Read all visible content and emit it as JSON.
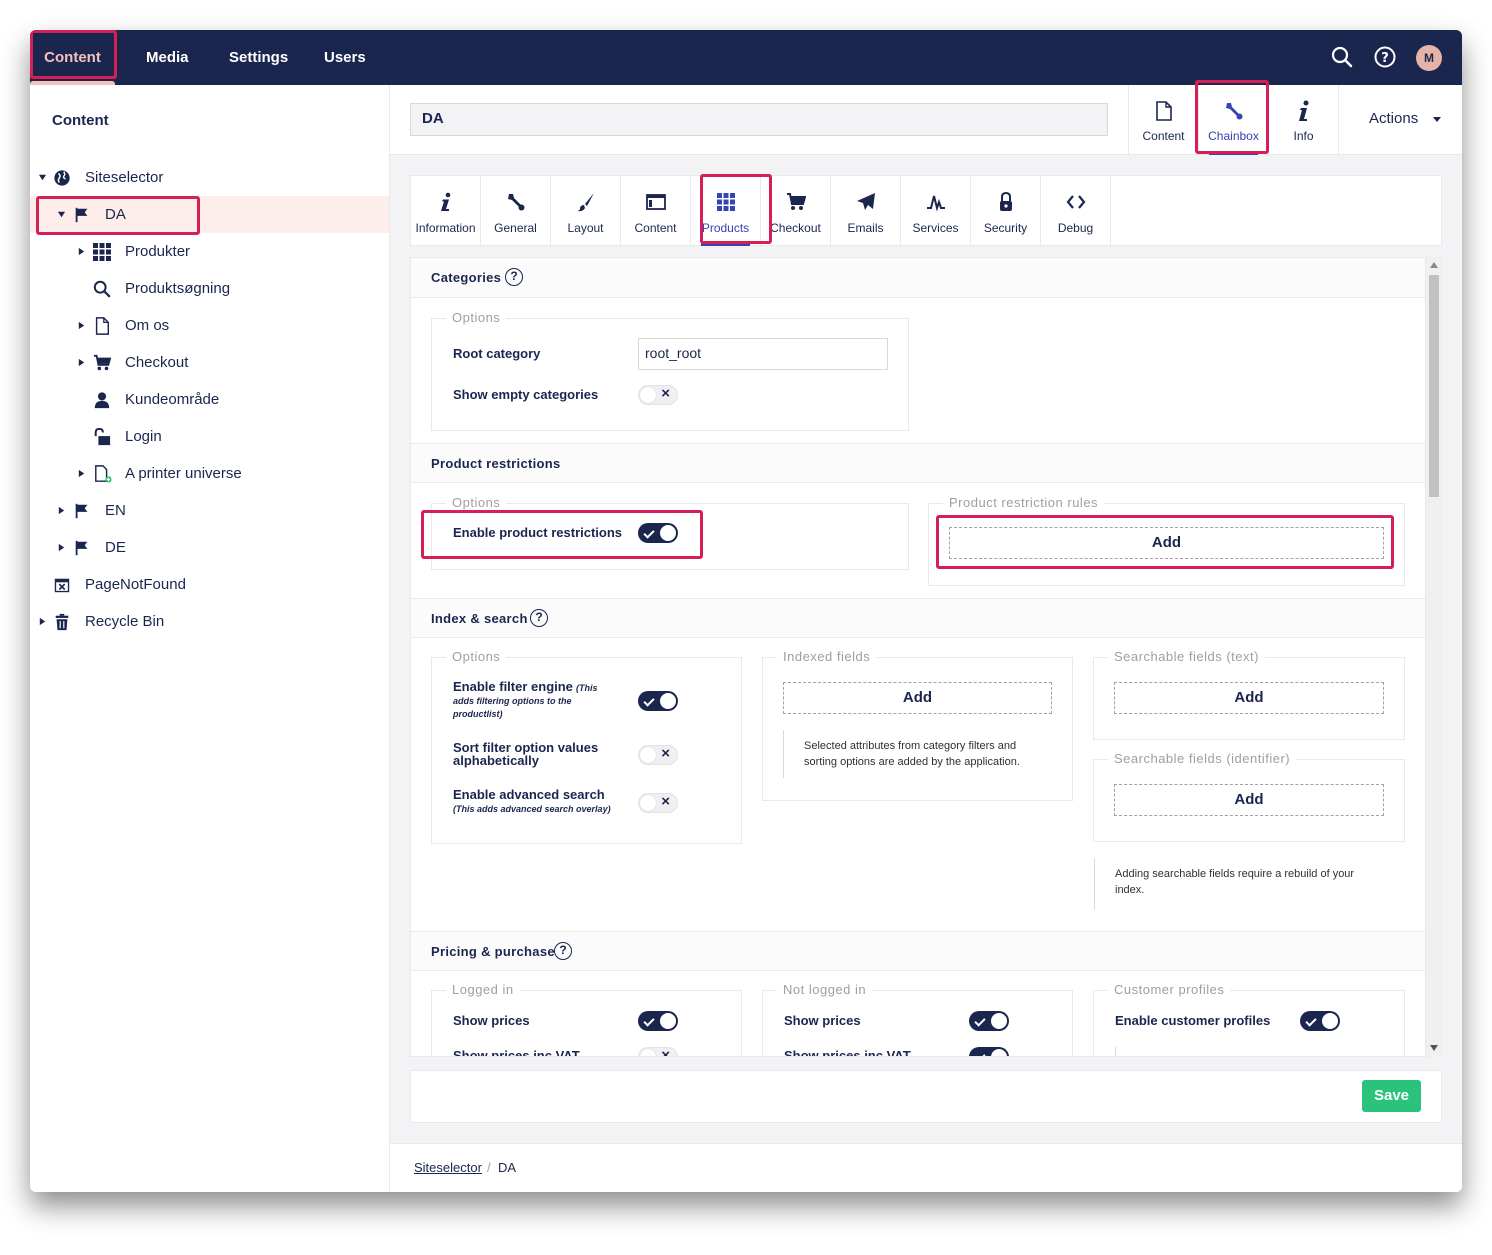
{
  "topnav": {
    "sections": [
      "Content",
      "Media",
      "Settings",
      "Users"
    ],
    "avatar_initial": "M"
  },
  "sidebar": {
    "title": "Content",
    "tree": [
      {
        "label": "Siteselector",
        "icon": "globe-icon"
      },
      {
        "label": "DA",
        "icon": "flag-icon"
      },
      {
        "label": "Produkter",
        "icon": "grid-icon"
      },
      {
        "label": "Produktsøgning",
        "icon": "search-icon"
      },
      {
        "label": "Om os",
        "icon": "document-icon"
      },
      {
        "label": "Checkout",
        "icon": "cart-icon"
      },
      {
        "label": "Kundeområde",
        "icon": "user-icon"
      },
      {
        "label": "Login",
        "icon": "unlock-icon"
      },
      {
        "label": "A printer universe",
        "icon": "document-add-icon"
      },
      {
        "label": "EN",
        "icon": "flag-icon"
      },
      {
        "label": "DE",
        "icon": "flag-icon"
      },
      {
        "label": "PageNotFound",
        "icon": "calendar-x-icon"
      },
      {
        "label": "Recycle Bin",
        "icon": "trash-icon"
      }
    ]
  },
  "editor": {
    "node_name": "DA",
    "apps": [
      "Content",
      "Chainbox",
      "Info"
    ],
    "actions_label": "Actions"
  },
  "tabs": [
    "Information",
    "General",
    "Layout",
    "Content",
    "Products",
    "Checkout",
    "Emails",
    "Services",
    "Security",
    "Debug"
  ],
  "categories": {
    "title": "Categories",
    "options_legend": "Options",
    "root_category_label": "Root category",
    "root_category_value": "root_root",
    "show_empty_label": "Show empty categories"
  },
  "product_restrictions": {
    "title": "Product restrictions",
    "options_legend": "Options",
    "enable_label": "Enable product restrictions",
    "rules_legend": "Product restriction rules",
    "add_label": "Add"
  },
  "index_search": {
    "title": "Index & search",
    "options_legend": "Options",
    "filter_engine_label": "Enable filter engine",
    "filter_engine_note_a": "(This",
    "filter_engine_note_b": "adds filtering options to the",
    "filter_engine_note_c": "productlist)",
    "sort_label_a": "Sort filter option values",
    "sort_label_b": "alphabetically",
    "advanced_label": "Enable advanced search",
    "advanced_note": "(This adds advanced search overlay)",
    "indexed_legend": "Indexed fields",
    "indexed_add": "Add",
    "indexed_note_a": "Selected attributes from category filters and",
    "indexed_note_b": "sorting options are added by the application.",
    "searchable_text_legend": "Searchable fields (text)",
    "searchable_text_add": "Add",
    "searchable_id_legend": "Searchable fields (identifier)",
    "searchable_id_add": "Add",
    "searchable_note_a": "Adding searchable fields require a rebuild of your",
    "searchable_note_b": "index."
  },
  "pricing": {
    "title": "Pricing & purchase",
    "logged_in_legend": "Logged in",
    "not_logged_in_legend": "Not logged in",
    "customer_profiles_legend": "Customer profiles",
    "show_prices": "Show prices",
    "show_prices_vat": "Show prices inc VAT",
    "enable_profiles": "Enable customer profiles"
  },
  "footer": {
    "save_label": "Save"
  },
  "breadcrumb": {
    "parent": "Siteselector",
    "separator": "/",
    "current": "DA"
  }
}
